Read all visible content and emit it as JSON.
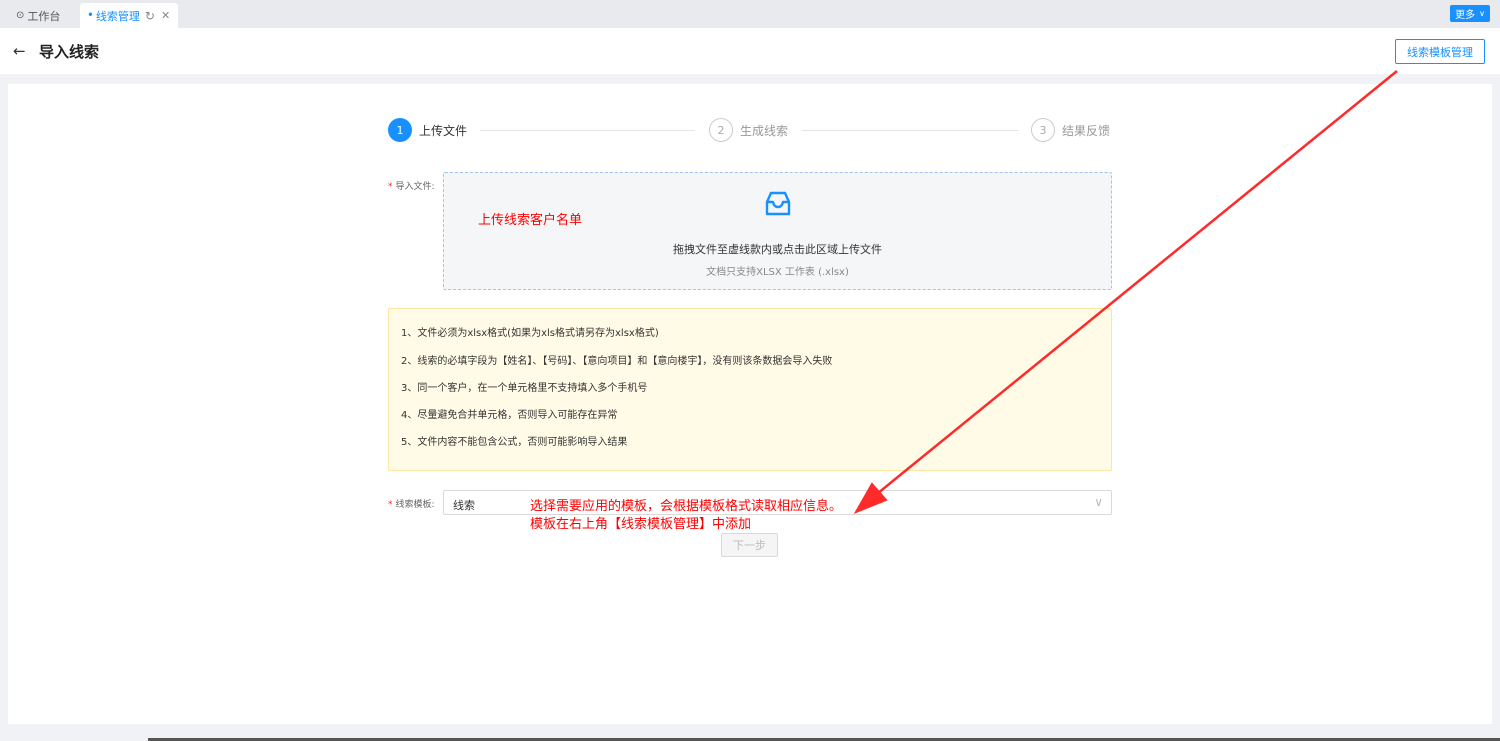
{
  "tabs": {
    "home_label": "工作台",
    "active_label": "线索管理",
    "more_label": "更多"
  },
  "header": {
    "title": "导入线索",
    "template_button": "线索模板管理"
  },
  "steps": [
    {
      "num": "1",
      "label": "上传文件"
    },
    {
      "num": "2",
      "label": "生成线索"
    },
    {
      "num": "3",
      "label": "结果反馈"
    }
  ],
  "form": {
    "file_label": "导入文件:",
    "upload_main": "拖拽文件至虚线款内或点击此区域上传文件",
    "upload_sub": "文档只支持XLSX 工作表 (.xlsx)",
    "template_label": "线索模板:",
    "template_value": "线索",
    "next_button": "下一步"
  },
  "notice": [
    "1、文件必须为xlsx格式(如果为xls格式请另存为xlsx格式)",
    "2、线索的必填字段为【姓名】、【号码】、【意向项目】和【意向楼宇】，没有则该条数据会导入失败",
    "3、同一个客户，在一个单元格里不支持填入多个手机号",
    "4、尽量避免合并单元格，否则导入可能存在异常",
    "5、文件内容不能包含公式，否则可能影响导入结果"
  ],
  "annotations": {
    "upload_note": "上传线索客户名单",
    "template_note_1": "选择需要应用的模板，会根据模板格式读取相应信息。",
    "template_note_2": "模板在右上角【线索模板管理】中添加"
  },
  "colors": {
    "primary": "#1890ff",
    "annotation": "#ff0000",
    "notice_bg": "#fffbe6"
  }
}
